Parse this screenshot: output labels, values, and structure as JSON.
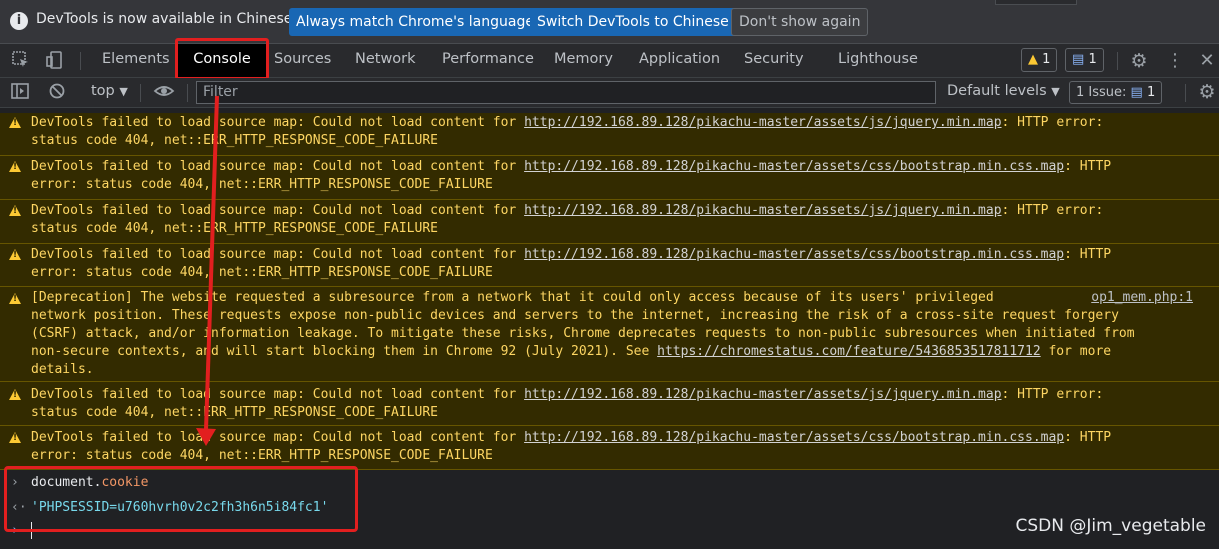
{
  "infobar": {
    "message": "DevTools is now available in Chinese!",
    "match_button": "Always match Chrome's language",
    "switch_button": "Switch DevTools to Chinese",
    "dismiss_button": "Don't show again"
  },
  "tabs": {
    "items": [
      "Elements",
      "Console",
      "Sources",
      "Network",
      "Performance",
      "Memory",
      "Application",
      "Security",
      "Lighthouse"
    ],
    "active": "Console",
    "warning_count": "1",
    "issue_count": "1"
  },
  "console_toolbar": {
    "context": "top",
    "filter_placeholder": "Filter",
    "levels": "Default levels",
    "issues_label": "1 Issue:",
    "issues_count": "1"
  },
  "messages": [
    {
      "lines": [
        "DevTools failed to load source map: Could not load content for ",
        "status code 404, net::ERR_HTTP_RESPONSE_CODE_FAILURE"
      ],
      "url": "http://192.168.89.128/pikachu-master/assets/js/jquery.min.map",
      "tail": ": HTTP error:"
    },
    {
      "lines": [
        "DevTools failed to load source map: Could not load content for ",
        "error: status code 404, net::ERR_HTTP_RESPONSE_CODE_FAILURE"
      ],
      "url": "http://192.168.89.128/pikachu-master/assets/css/bootstrap.min.css.map",
      "tail": ": HTTP"
    },
    {
      "lines": [
        "DevTools failed to load source map: Could not load content for ",
        "status code 404, net::ERR_HTTP_RESPONSE_CODE_FAILURE"
      ],
      "url": "http://192.168.89.128/pikachu-master/assets/js/jquery.min.map",
      "tail": ": HTTP error:"
    },
    {
      "lines": [
        "DevTools failed to load source map: Could not load content for ",
        "error: status code 404, net::ERR_HTTP_RESPONSE_CODE_FAILURE"
      ],
      "url": "http://192.168.89.128/pikachu-master/assets/css/bootstrap.min.css.map",
      "tail": ": HTTP"
    },
    {
      "deprecation": [
        "[Deprecation] The website requested a subresource from a network that it could only access because of its users' privileged",
        "network position. These requests expose non-public devices and servers to the internet, increasing the risk of a cross-site request forgery",
        "(CSRF) attack, and/or information leakage. To mitigate these risks, Chrome deprecates requests to non-public subresources when initiated from",
        "non-secure contexts, and will start blocking them in Chrome 92 (July 2021). See ",
        "details."
      ],
      "deprecation_url": "https://chromestatus.com/feature/5436853517811712",
      "deprecation_tail": " for more",
      "source": "op1_mem.php:1"
    },
    {
      "lines": [
        "DevTools failed to load source map: Could not load content for ",
        "status code 404, net::ERR_HTTP_RESPONSE_CODE_FAILURE"
      ],
      "url": "http://192.168.89.128/pikachu-master/assets/js/jquery.min.map",
      "tail": ": HTTP error:"
    },
    {
      "lines": [
        "DevTools failed to load source map: Could not load content for ",
        "error: status code 404, net::ERR_HTTP_RESPONSE_CODE_FAILURE"
      ],
      "url": "http://192.168.89.128/pikachu-master/assets/css/bootstrap.min.css.map",
      "tail": ": HTTP"
    }
  ],
  "input": {
    "command_object": "document.",
    "command_property": "cookie",
    "result": "'PHPSESSID=u760hvrh0v2c2fh3h6n5i84fc1'"
  },
  "watermark": "CSDN @Jim_vegetable",
  "colors": {
    "highlight": "#e21f1f",
    "warning_bg": "#332b00",
    "warning_text": "#fdd663",
    "accent_button": "#1967b4"
  }
}
